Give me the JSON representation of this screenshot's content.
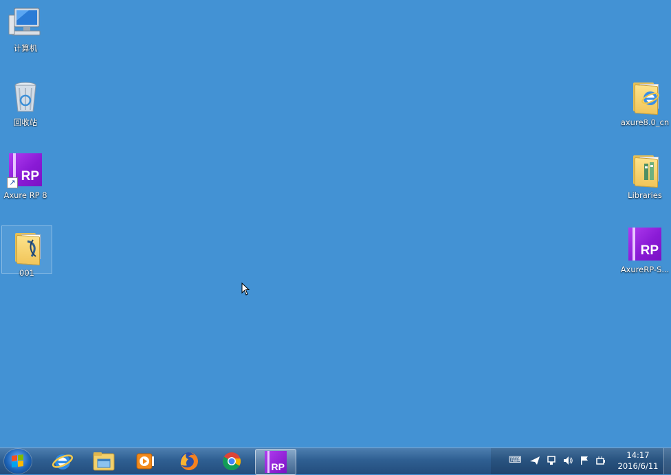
{
  "desktop": {
    "icons": [
      {
        "label": "计算机",
        "type": "computer"
      },
      {
        "label": "回收站",
        "type": "recycle-bin"
      },
      {
        "label": "Axure RP 8",
        "type": "axure-shortcut"
      },
      {
        "label": "001",
        "type": "folder",
        "selected": true
      },
      {
        "label": "axure8.0_cn",
        "type": "folder-ie"
      },
      {
        "label": "Libraries",
        "type": "folder-libraries"
      },
      {
        "label": "AxureRP-S...",
        "type": "axure-app"
      }
    ]
  },
  "taskbar": {
    "start_icon": "windows-logo-icon",
    "pinned": [
      {
        "name": "internet-explorer-icon"
      },
      {
        "name": "file-explorer-icon"
      },
      {
        "name": "media-player-icon"
      },
      {
        "name": "firefox-icon"
      },
      {
        "name": "chrome-icon"
      },
      {
        "name": "axure-rp-icon",
        "label": "RP",
        "active": true
      }
    ],
    "tray": {
      "icons": [
        "keyboard-icon",
        "send-icon",
        "network-icon",
        "volume-icon",
        "action-center-flag-icon",
        "power-icon"
      ],
      "time": "14:17",
      "date": "2016/6/11"
    }
  },
  "colors": {
    "desktop_background": "#4392d4",
    "axure_purple": "#8a1bd6"
  }
}
